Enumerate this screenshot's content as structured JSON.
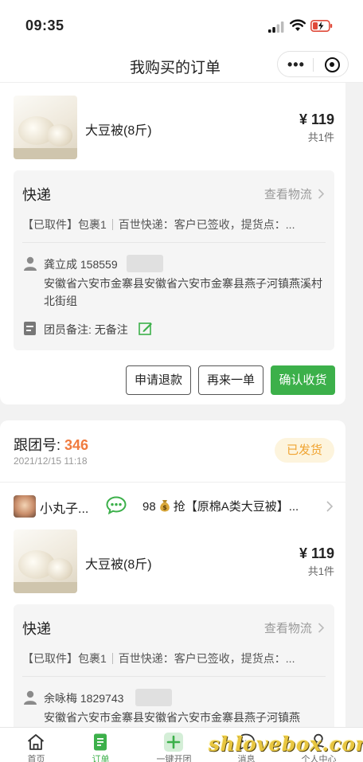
{
  "status_bar": {
    "time": "09:35"
  },
  "nav": {
    "title": "我购买的订单"
  },
  "orders": [
    {
      "product": {
        "name": "大豆被(8斤)",
        "price": "¥ 119",
        "qty": "共1件"
      },
      "shipping": {
        "title": "快递",
        "link": "查看物流",
        "status_tag": "【已取件】包裹1",
        "status_text": "百世快递：客户已签收，提货点：..."
      },
      "recipient": {
        "name_phone": "龚立成   158559",
        "address": "安徽省六安市金寨县安徽省六安市金寨县燕子河镇燕溪村北街组"
      },
      "note": "团员备注: 无备注",
      "actions": {
        "refund": "申请退款",
        "reorder": "再来一单",
        "confirm": "确认收货"
      }
    },
    {
      "group_label": "跟团号: ",
      "group_number": "346",
      "date": "2021/12/15 11:18",
      "badge": "已发货",
      "leader": {
        "name": "小丸子...",
        "desc_count": "98",
        "desc_text": "抢【原棉A类大豆被】..."
      },
      "product": {
        "name": "大豆被(8斤)",
        "price": "¥ 119",
        "qty": "共1件"
      },
      "shipping": {
        "title": "快递",
        "link": "查看物流",
        "status_tag": "【已取件】包裹1",
        "status_text": "百世快递：客户已签收，提货点：..."
      },
      "recipient": {
        "name_phone": "余咏梅   1829743",
        "address": "安徽省六安市金寨县安徽省六安市金寨县燕子河镇燕"
      }
    }
  ],
  "tabbar": [
    "首页",
    "订单",
    "一键开团",
    "消息",
    "个人中心"
  ],
  "watermark": "shlovebox.com",
  "colors": {
    "accent": "#3cb04a",
    "group_number": "#f07b3f",
    "badge_text": "#f0a432",
    "badge_bg": "#fdf4dd"
  }
}
